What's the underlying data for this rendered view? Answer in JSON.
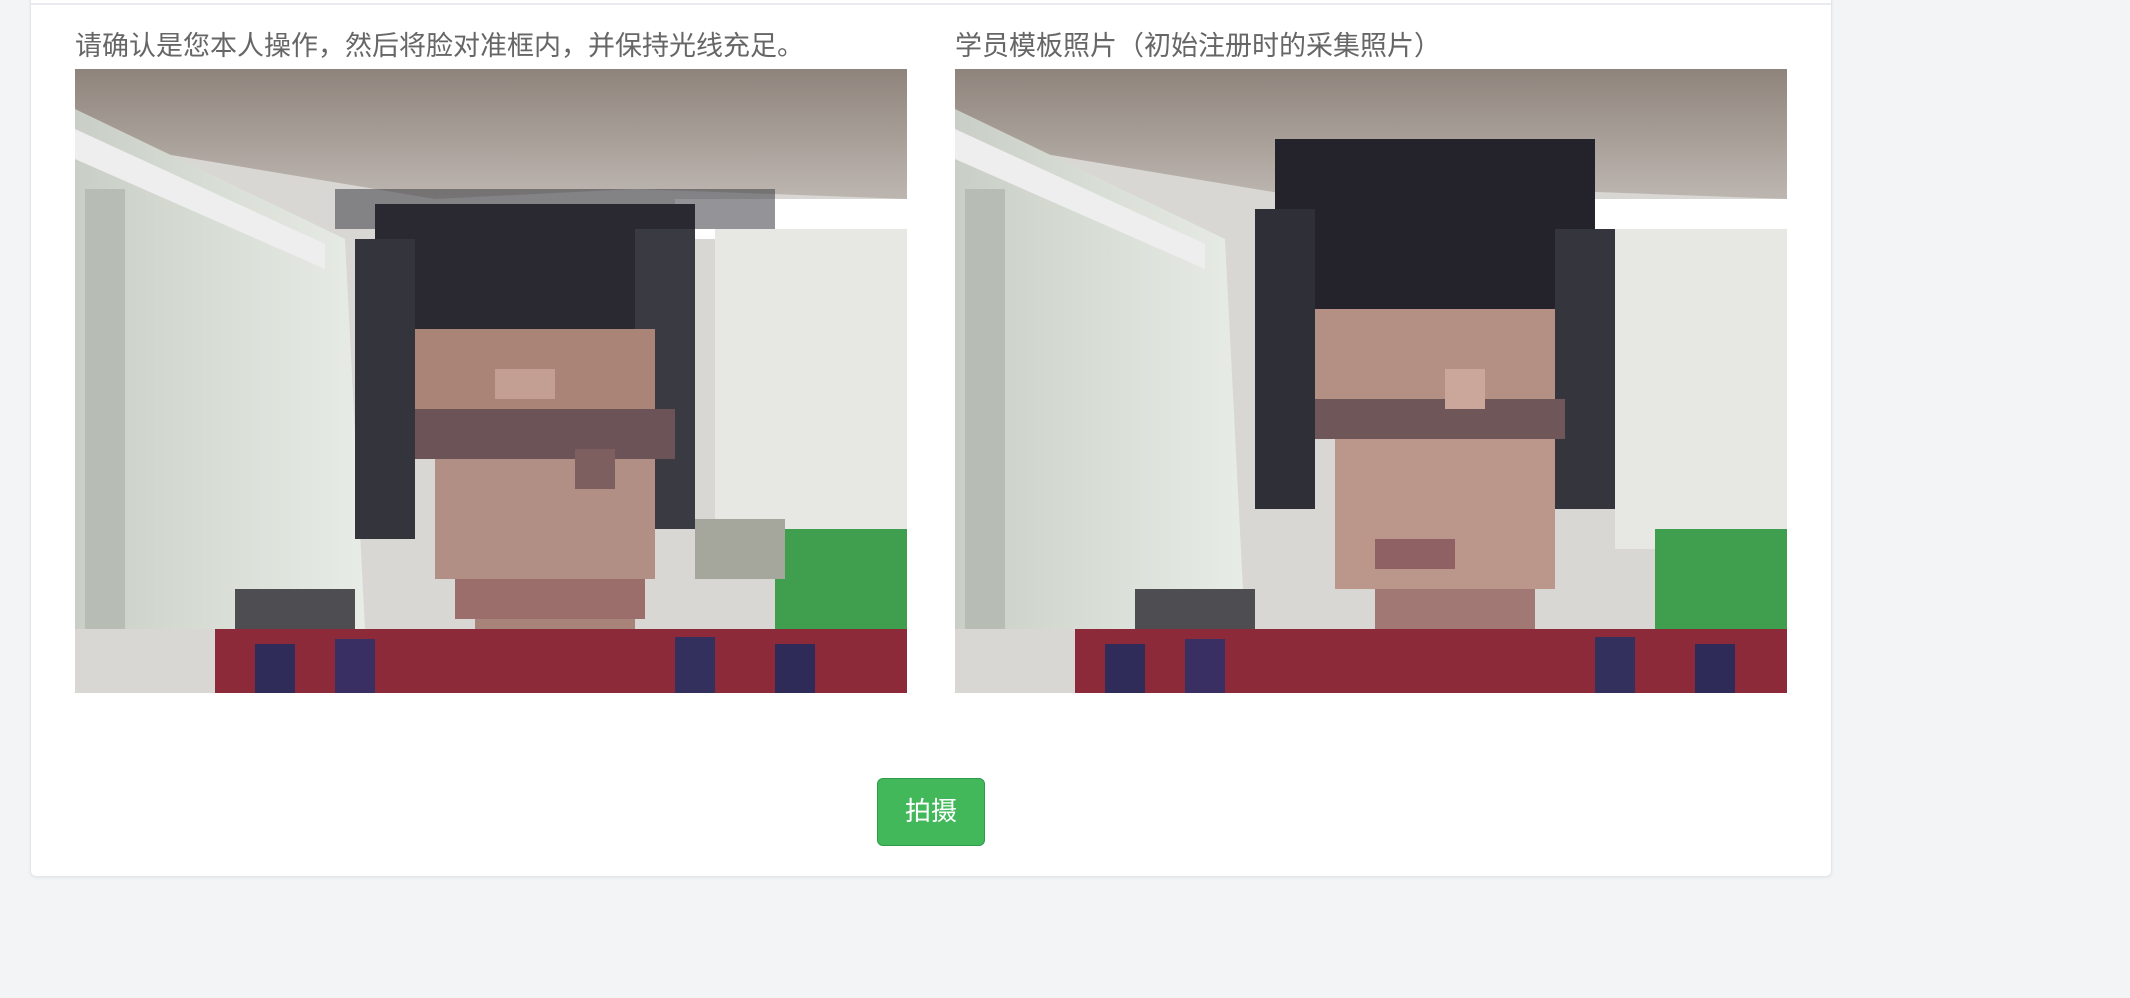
{
  "instructions": {
    "live_caption": "请确认是您本人操作，然后将脸对准框内，并保持光线充足。",
    "template_caption": "学员模板照片（初始注册时的采集照片）"
  },
  "actions": {
    "capture_label": "拍摄"
  },
  "colors": {
    "button_green": "#43b85b",
    "caption_gray": "#666666",
    "page_background": "#f3f4f6"
  }
}
